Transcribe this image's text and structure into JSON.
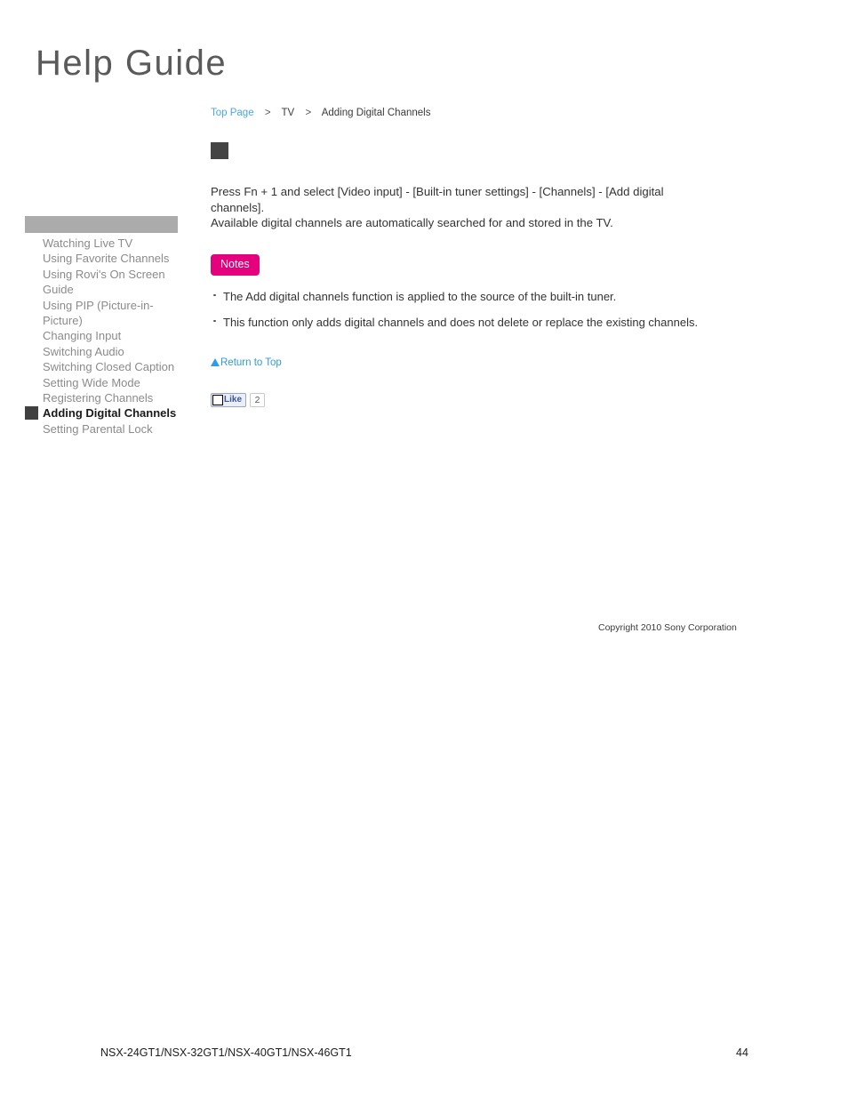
{
  "header": {
    "logo_text": "Help Guide"
  },
  "breadcrumb": {
    "items": [
      {
        "label": "Top Page",
        "type": "link"
      },
      {
        "label": "TV",
        "type": "static"
      },
      {
        "label": "Adding Digital Channels",
        "type": "current"
      }
    ],
    "separator": ">"
  },
  "sidebar": {
    "items": [
      {
        "label": "Watching Live TV",
        "active": false
      },
      {
        "label": "Using Favorite Channels",
        "active": false
      },
      {
        "label": "Using Rovi's On Screen Guide",
        "active": false
      },
      {
        "label": "Using PIP (Picture-in-Picture)",
        "active": false
      },
      {
        "label": "Changing Input",
        "active": false
      },
      {
        "label": "Switching Audio",
        "active": false
      },
      {
        "label": "Switching Closed Caption",
        "active": false
      },
      {
        "label": "Setting Wide Mode",
        "active": false
      },
      {
        "label": "Registering Channels",
        "active": false
      },
      {
        "label": "Adding Digital Channels",
        "active": true
      },
      {
        "label": "Setting Parental Lock",
        "active": false
      }
    ]
  },
  "main": {
    "body_paragraphs": [
      "Press Fn + 1 and select [Video input] - [Built-in tuner settings] - [Channels] - [Add digital channels].",
      "Available digital channels are automatically searched for and stored in the TV."
    ],
    "notes": {
      "badge_label": "Notes",
      "items": [
        "The Add digital channels function is applied to the source of the built-in tuner.",
        "This function only adds digital channels and does not delete or replace the existing channels."
      ]
    },
    "return_to_top_label": "Return to Top",
    "like": {
      "label": "Like",
      "count": "2"
    }
  },
  "copyright": {
    "text": "Copyright 2010 Sony Corporation"
  },
  "footer": {
    "models": "NSX-24GT1/NSX-32GT1/NSX-40GT1/NSX-46GT1",
    "page_number": "44"
  },
  "colors": {
    "notes_badge": "#e5007d",
    "link_blue": "#4aa8e0",
    "return_top_blue": "#2e9ae0",
    "sidebar_header_gray": "#ababab",
    "marker_dark": "#404040",
    "topic_block_dark": "#444444",
    "like_text_blue": "#3b5998"
  }
}
